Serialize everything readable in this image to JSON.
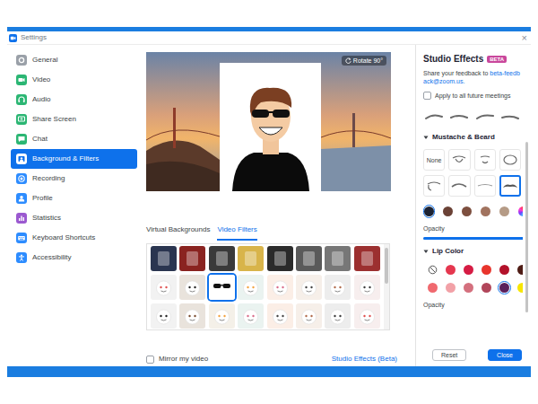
{
  "window": {
    "title": "Settings",
    "close": "×"
  },
  "sidebar": {
    "items": [
      {
        "label": "General",
        "selected": false
      },
      {
        "label": "Video",
        "selected": false
      },
      {
        "label": "Audio",
        "selected": false
      },
      {
        "label": "Share Screen",
        "selected": false
      },
      {
        "label": "Chat",
        "selected": false
      },
      {
        "label": "Background & Filters",
        "selected": true
      },
      {
        "label": "Recording",
        "selected": false
      },
      {
        "label": "Profile",
        "selected": false
      },
      {
        "label": "Statistics",
        "selected": false
      },
      {
        "label": "Keyboard Shortcuts",
        "selected": false
      },
      {
        "label": "Accessibility",
        "selected": false
      }
    ]
  },
  "preview": {
    "rotate_button": "Rotate 90°"
  },
  "tabs": [
    {
      "label": "Virtual Backgrounds",
      "selected": false
    },
    {
      "label": "Video Filters",
      "selected": true
    }
  ],
  "filters": [
    {
      "selected": false
    },
    {
      "selected": false
    },
    {
      "selected": false
    },
    {
      "selected": false
    },
    {
      "selected": false
    },
    {
      "selected": false
    },
    {
      "selected": false
    },
    {
      "selected": false
    },
    {
      "selected": false
    },
    {
      "selected": false
    },
    {
      "selected": true
    },
    {
      "selected": false
    },
    {
      "selected": false
    },
    {
      "selected": false
    },
    {
      "selected": false
    },
    {
      "selected": false
    },
    {
      "selected": false
    },
    {
      "selected": false
    },
    {
      "selected": false
    },
    {
      "selected": false
    },
    {
      "selected": false
    },
    {
      "selected": false
    },
    {
      "selected": false
    },
    {
      "selected": false
    },
    {
      "selected": false
    },
    {
      "selected": false
    },
    {
      "selected": false
    },
    {
      "selected": false
    },
    {
      "selected": false
    },
    {
      "selected": false
    },
    {
      "selected": false
    },
    {
      "selected": false
    }
  ],
  "mirror": {
    "label": "Mirror my video",
    "checked": false
  },
  "studio_effects_link": "Studio Effects (Beta)",
  "studio": {
    "title": "Studio Effects",
    "badge": "BETA",
    "feedback_text": "Share your feedback to ",
    "feedback_link": "beta-feedback@zoom.us.",
    "apply_all": {
      "label": "Apply to all future meetings",
      "checked": false
    },
    "eyebrows": [
      {
        "selected": false
      },
      {
        "selected": false
      },
      {
        "selected": false
      },
      {
        "selected": false
      }
    ],
    "sections": [
      {
        "title": "Mustache & Beard",
        "expanded": true,
        "options": [
          {
            "kind": "none",
            "label": "None",
            "selected": false
          },
          {
            "kind": "shape",
            "selected": false
          },
          {
            "kind": "shape",
            "selected": false
          },
          {
            "kind": "shape",
            "selected": false
          },
          {
            "kind": "shape",
            "selected": false
          },
          {
            "kind": "shape",
            "selected": false
          },
          {
            "kind": "shape",
            "selected": false
          },
          {
            "kind": "shape",
            "selected": true
          }
        ],
        "colors": [
          {
            "kind": "swatch",
            "color": "#1c2333",
            "selected": true
          },
          {
            "kind": "swatch",
            "color": "#6b4236",
            "selected": false
          },
          {
            "kind": "swatch",
            "color": "#7d4f3f",
            "selected": false
          },
          {
            "kind": "swatch",
            "color": "#a1735f",
            "selected": false
          },
          {
            "kind": "swatch",
            "color": "#b59b86",
            "selected": false
          },
          {
            "kind": "custom",
            "selected": false
          }
        ],
        "opacity": {
          "label": "Opacity",
          "level": 1
        }
      },
      {
        "title": "Lip Color",
        "expanded": true,
        "colors": [
          {
            "kind": "none",
            "selected": false
          },
          {
            "kind": "swatch",
            "color": "#e5374f",
            "selected": false
          },
          {
            "kind": "swatch",
            "color": "#d61c44",
            "selected": false
          },
          {
            "kind": "swatch",
            "color": "#e8352d",
            "selected": false
          },
          {
            "kind": "swatch",
            "color": "#b3122a",
            "selected": false
          },
          {
            "kind": "swatch",
            "color": "#4f1c15",
            "selected": false
          },
          {
            "kind": "swatch",
            "color": "#f0696f",
            "selected": false
          },
          {
            "kind": "swatch",
            "color": "#f2a1a7",
            "selected": false
          },
          {
            "kind": "swatch",
            "color": "#d4707e",
            "selected": false
          },
          {
            "kind": "swatch",
            "color": "#b1465a",
            "selected": false
          },
          {
            "kind": "swatch",
            "color": "#5a1f5c",
            "selected": true
          },
          {
            "kind": "swatch",
            "color": "#f7e600",
            "selected": false
          }
        ],
        "opacity": {
          "label": "Opacity"
        }
      }
    ]
  },
  "buttons": [
    {
      "label": "Reset",
      "kind": "secondary"
    },
    {
      "label": "Close",
      "kind": "primary"
    }
  ]
}
